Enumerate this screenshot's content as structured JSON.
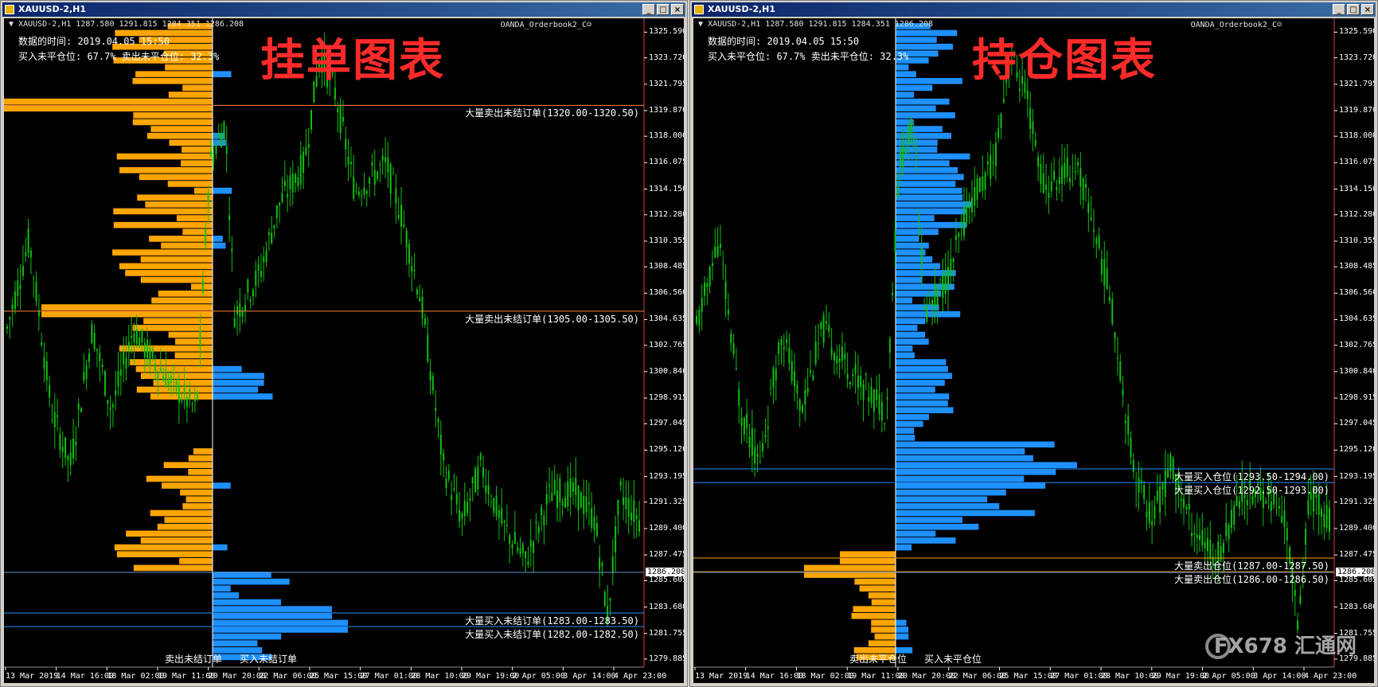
{
  "colors": {
    "sell_bar": "#ffa500",
    "buy_bar": "#1e90ff",
    "candle": "#10c010",
    "axis_border": "#d64040"
  },
  "price_axis": [
    "1325.590",
    "1323.720",
    "1321.795",
    "1319.870",
    "1318.000",
    "1316.075",
    "1314.150",
    "1312.280",
    "1310.355",
    "1308.485",
    "1306.560",
    "1304.635",
    "1302.765",
    "1300.840",
    "1298.915",
    "1297.045",
    "1295.120",
    "1293.195",
    "1291.325",
    "1289.400",
    "1287.475",
    "1285.605",
    "1283.680",
    "1281.755",
    "1279.885"
  ],
  "time_axis": [
    "13 Mar 2019",
    "14 Mar 16:00",
    "18 Mar 02:00",
    "19 Mar 11:00",
    "20 Mar 20:00",
    "22 Mar 06:00",
    "25 Mar 15:00",
    "27 Mar 01:00",
    "28 Mar 10:00",
    "29 Mar 19:00",
    "2 Apr 05:00",
    "3 Apr 14:00",
    "4 Apr 23:00"
  ],
  "current_price": "1286.208",
  "left": {
    "window_title": "XAUUSD-2,H1",
    "ohlc": "XAUUSD-2,H1  1287.580 1291.815 1284.351 1286.208",
    "indicator": "OANDA_Orderbook2_C",
    "info_time": "数据的时间: 2019.04.05 15:50",
    "info_ratio": "买入未平仓位: 67.7%  卖出未平仓位: 32.3%",
    "big_title": "挂单图表",
    "levels": [
      {
        "label": "大量卖出未结订单(1320.00-1320.50)",
        "price": 1320.25
      },
      {
        "label": "大量卖出未结订单(1305.00-1305.50)",
        "price": 1305.25
      },
      {
        "label": "大量买入未结订单(1283.00-1283.50)",
        "price": 1283.25
      },
      {
        "label": "大量买入未结订单(1282.00-1282.50)",
        "price": 1282.25
      }
    ],
    "bottom_sell": "卖出未结订单",
    "bottom_buy": "买入未结订单"
  },
  "right": {
    "window_title": "XAUUSD-2,H1",
    "ohlc": "XAUUSD-2,H1  1287.580 1291.815 1284.351 1286.208",
    "indicator": "OANDA_Orderbook2_C",
    "info_time": "数据的时间: 2019.04.05 15:50",
    "info_ratio": "买入未平仓位: 67.7%  卖出未平仓位: 32.3%",
    "big_title": "持仓图表",
    "levels": [
      {
        "label": "大量买入仓位(1293.50-1294.00)",
        "price": 1293.75
      },
      {
        "label": "大量买入仓位(1292.50-1293.00)",
        "price": 1292.75
      },
      {
        "label": "大量卖出仓位(1287.00-1287.50)",
        "price": 1287.25
      },
      {
        "label": "大量卖出仓位(1286.00-1286.50)",
        "price": 1286.25
      }
    ],
    "bottom_sell": "卖出未平仓位",
    "bottom_buy": "买入未平仓位"
  },
  "watermark": "FX678 汇通网"
}
